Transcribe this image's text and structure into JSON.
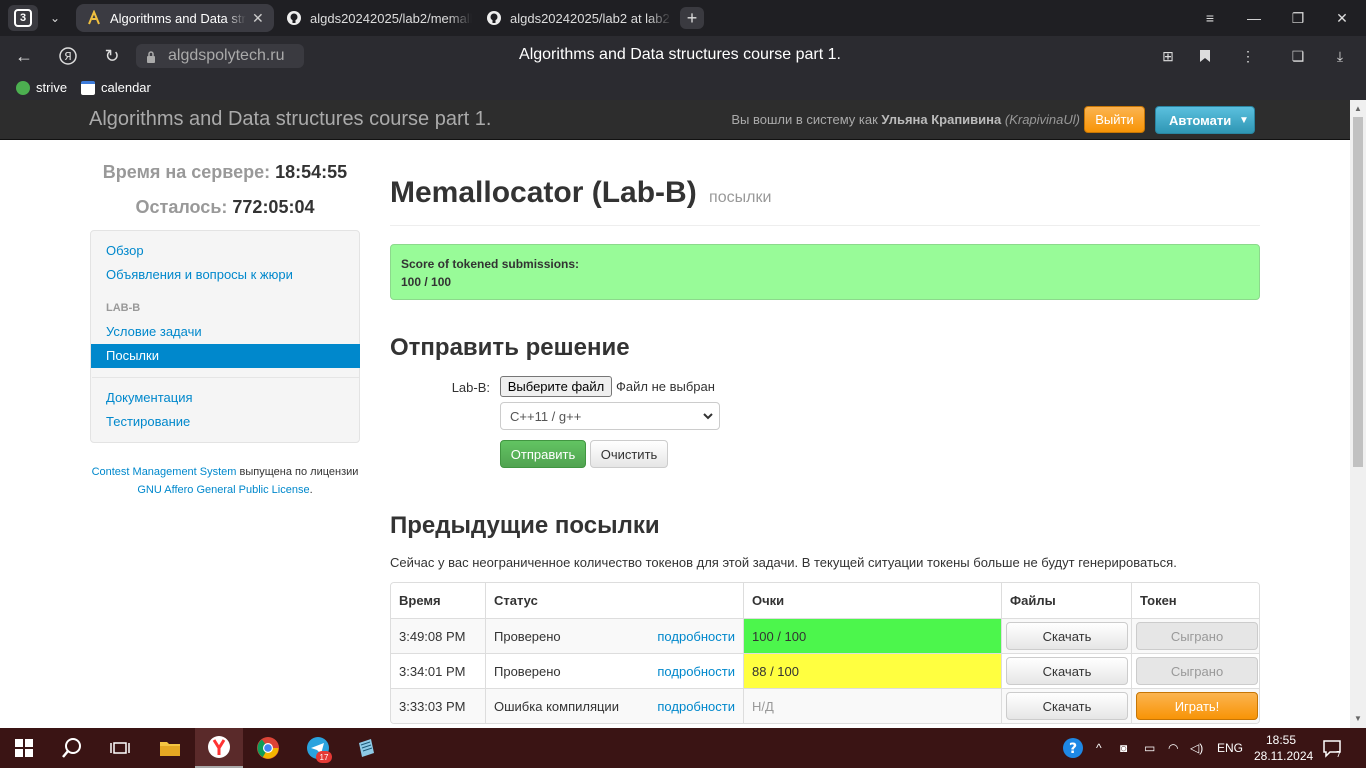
{
  "browser": {
    "tab_count": "3",
    "tabs": [
      {
        "label": "Algorithms and Data structures course part 1."
      },
      {
        "label": "algds20242025/lab2/memallocator"
      },
      {
        "label": "algds20242025/lab2 at lab2"
      }
    ],
    "domain": "algdspolytech.ru",
    "page_title": "Algorithms and Data structures course part 1.",
    "bookmarks": [
      {
        "label": "strive"
      },
      {
        "label": "calendar"
      }
    ]
  },
  "header": {
    "brand": "Algorithms and Data structures course part 1.",
    "login_prefix": "Вы вошли в систему как",
    "user_name": "Ульяна Крапивина",
    "user_login": "(KrapivinaUl)",
    "logout_label": "Выйти",
    "auto_label": "Автомати"
  },
  "sidebar": {
    "server_time_label": "Время на сервере:",
    "server_time": "18:54:55",
    "remaining_label": "Осталось:",
    "remaining": "772:05:04",
    "items": [
      {
        "label": "Обзор"
      },
      {
        "label": "Объявления и вопросы к жюри"
      }
    ],
    "section_header": "LAB-B",
    "task_items": [
      {
        "label": "Условие задачи"
      },
      {
        "label": "Посылки"
      }
    ],
    "extra_items": [
      {
        "label": "Документация"
      },
      {
        "label": "Тестирование"
      }
    ],
    "footer": {
      "cms_link": "Contest Management System",
      "text1": "выпущена по лицензии",
      "license_link": "GNU Affero General Public License",
      "text2": "."
    }
  },
  "main": {
    "title": "Memallocator (Lab-B)",
    "subtitle": "посылки",
    "score_box": {
      "label": "Score of tokened submissions:",
      "value": "100 / 100"
    },
    "submit_heading": "Отправить решение",
    "file_label": "Lab-B:",
    "file_button": "Выберите файл",
    "file_none": "Файл не выбран",
    "language_selected": "C++11 / g++",
    "submit_button": "Отправить",
    "clear_button": "Очистить",
    "previous_heading": "Предыдущие посылки",
    "tokens_note": "Сейчас у вас неограниченное количество токенов для этой задачи. В текущей ситуации токены больше не будут генерироваться.",
    "table": {
      "headers": {
        "time": "Время",
        "status": "Статус",
        "score": "Очки",
        "files": "Файлы",
        "token": "Токен"
      },
      "rows": [
        {
          "time": "3:49:08 PM",
          "status": "Проверено",
          "details": "подробности",
          "score": "100 / 100",
          "files": "Скачать",
          "token": "Сыграно"
        },
        {
          "time": "3:34:01 PM",
          "status": "Проверено",
          "details": "подробности",
          "score": "88 / 100",
          "files": "Скачать",
          "token": "Сыграно"
        },
        {
          "time": "3:33:03 PM",
          "status": "Ошибка компиляции",
          "details": "подробности",
          "score": "Н/Д",
          "files": "Скачать",
          "token": "Играть!"
        }
      ]
    }
  },
  "taskbar": {
    "telegram_badge": "17",
    "language": "ENG",
    "time": "18:55",
    "date": "28.11.2024",
    "notifications": "7"
  },
  "colors": {
    "accent_link": "#0088cc",
    "score_full": "#4cf64c",
    "score_partial": "#ffff40",
    "score_box_bg": "#98fb98",
    "logout_orange": "#f89406",
    "taskbar_bg": "#3a1414"
  }
}
